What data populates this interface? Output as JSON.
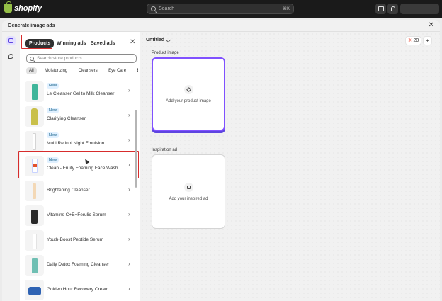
{
  "topbar": {
    "brand": "shopify",
    "search_placeholder": "Search",
    "search_shortcut": "⌘K"
  },
  "modal": {
    "title": "Generate image ads"
  },
  "panel": {
    "tabs": [
      {
        "label": "Products"
      },
      {
        "label": "Winning ads"
      },
      {
        "label": "Saved ads"
      }
    ],
    "search_placeholder": "Search store products",
    "filters": [
      {
        "label": "All"
      },
      {
        "label": "Moisturizing"
      },
      {
        "label": "Cleansers"
      },
      {
        "label": "Eye Care"
      },
      {
        "label": "Ba"
      }
    ],
    "products": [
      {
        "name": "Le Cleanser Gel to Milk Cleanser",
        "badge": "New"
      },
      {
        "name": "Clarifying Cleanser",
        "badge": "New"
      },
      {
        "name": "Multi Retinol Night Emulsion",
        "badge": "New"
      },
      {
        "name": "Clean - Fruity Foaming Face Wash",
        "badge": "New"
      },
      {
        "name": "Brightening Cleanser",
        "badge": ""
      },
      {
        "name": "Vitamins C+E+Ferulic Serum",
        "badge": ""
      },
      {
        "name": "Youth-Boost Peptide Serum",
        "badge": ""
      },
      {
        "name": "Daily Detox Foaming Cleanser",
        "badge": ""
      },
      {
        "name": "Golden Hour Recovery Cream",
        "badge": ""
      }
    ]
  },
  "canvas": {
    "title": "Untitled",
    "credits": "20",
    "add_label": "+",
    "product_image": {
      "label": "Product image",
      "cta": "Add your product image"
    },
    "inspiration": {
      "label": "Inspiration ad",
      "cta": "Add your inspired ad"
    }
  },
  "colors": {
    "topbar": "#1a1a1a",
    "accent_purple": "#8051ff",
    "highlight_red": "#d72c2c"
  }
}
